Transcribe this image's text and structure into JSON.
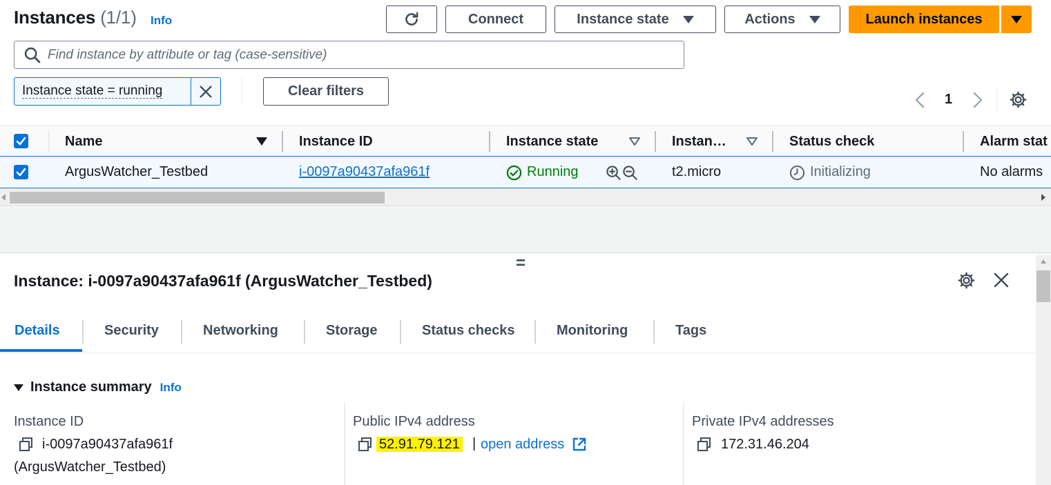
{
  "header": {
    "title": "Instances",
    "count": "(1/1)",
    "info": "Info",
    "refresh_icon": "refresh-icon",
    "connect_label": "Connect",
    "instance_state_label": "Instance state",
    "actions_label": "Actions",
    "launch_label": "Launch instances"
  },
  "search": {
    "placeholder": "Find instance by attribute or tag (case-sensitive)"
  },
  "filters": {
    "token_label": "Instance state = running",
    "clear_label": "Clear filters"
  },
  "pagination": {
    "page": "1"
  },
  "table": {
    "columns": [
      "Name",
      "Instance ID",
      "Instance state",
      "Instan…",
      "Status check",
      "Alarm stat"
    ],
    "rows": [
      {
        "name": "ArgusWatcher_Testbed",
        "instance_id": "i-0097a90437afa961f",
        "state": "Running",
        "type": "t2.micro",
        "status_check": "Initializing",
        "alarm": "No alarms"
      }
    ]
  },
  "details": {
    "title": "Instance: i-0097a90437afa961f (ArgusWatcher_Testbed)",
    "resize_handle": "=",
    "tabs": [
      "Details",
      "Security",
      "Networking",
      "Storage",
      "Status checks",
      "Monitoring",
      "Tags"
    ],
    "section_title": "Instance summary",
    "section_info": "Info",
    "fields": {
      "instance_id_label": "Instance ID",
      "instance_id_value": "i-0097a90437afa961f",
      "instance_id_name": "(ArgusWatcher_Testbed)",
      "public_ip_label": "Public IPv4 address",
      "public_ip_value": "52.91.79.121",
      "separator": "|",
      "open_address": "open address",
      "private_ip_label": "Private IPv4 addresses",
      "private_ip_value": "172.31.46.204"
    }
  },
  "colors": {
    "accent": "#0972d3",
    "primary_button": "#ff9900",
    "success": "#037f0c",
    "highlight": "#fff200"
  }
}
